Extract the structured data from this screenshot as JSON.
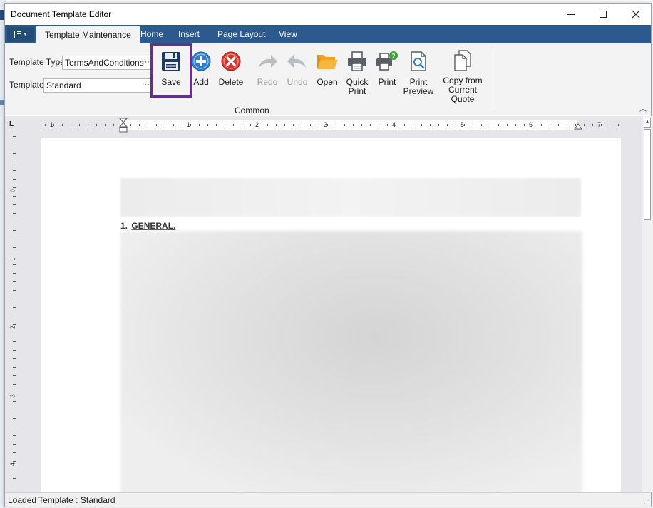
{
  "window": {
    "title": "Document Template Editor"
  },
  "tabs": [
    {
      "label": "Template Maintenance",
      "active": true
    },
    {
      "label": "Home",
      "active": false
    },
    {
      "label": "Insert",
      "active": false
    },
    {
      "label": "Page Layout",
      "active": false
    },
    {
      "label": "View",
      "active": false
    }
  ],
  "fields": {
    "template_type_label": "Template Type",
    "template_type_value": "TermsAndConditions",
    "template_label": "Template",
    "template_value": "Standard",
    "dots": "···"
  },
  "buttons": {
    "save": "Save",
    "add": "Add",
    "delete": "Delete",
    "redo": "Redo",
    "undo": "Undo",
    "open": "Open",
    "quick_print_1": "Quick",
    "quick_print_2": "Print",
    "print": "Print",
    "print_preview_1": "Print",
    "print_preview_2": "Preview",
    "copy_quote_1": "Copy from",
    "copy_quote_2": "Current Quote"
  },
  "group": {
    "common": "Common"
  },
  "ruler": {
    "corner": "L",
    "h_numbers": [
      "1",
      "1",
      "2",
      "3",
      "4",
      "5",
      "6",
      "7"
    ],
    "v_numbers": [
      "0",
      "1",
      "2",
      "3",
      "4"
    ]
  },
  "document": {
    "heading_number": "1.",
    "heading_text": "GENERAL."
  },
  "status": {
    "text": "Loaded Template : Standard"
  },
  "colors": {
    "ribbon_tab_bar": "#2c5a8f",
    "highlight": "#6b2c8c",
    "save_icon": "#1f3a66",
    "add_icon": "#2f7fd0",
    "delete_icon": "#d8342c",
    "open_icon": "#f4a020",
    "print_badge": "#3da33d"
  }
}
